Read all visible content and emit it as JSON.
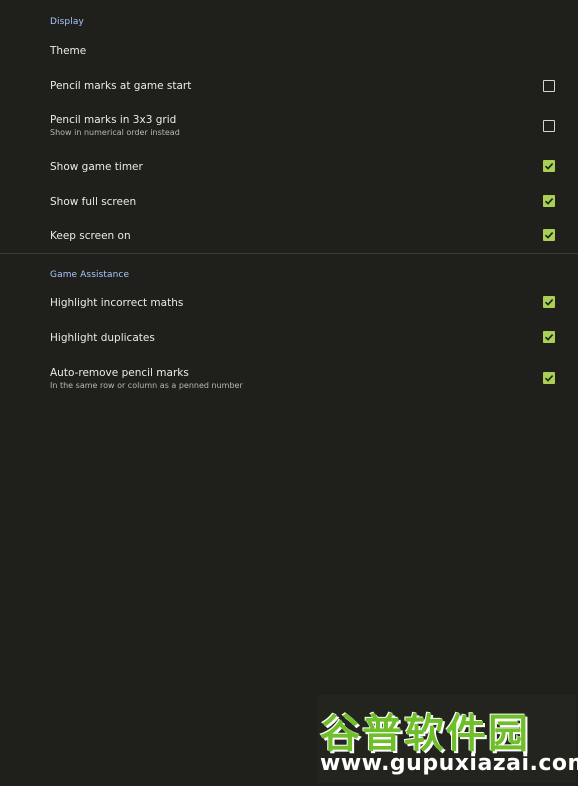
{
  "display": {
    "title": "Display",
    "items": [
      {
        "label": "Theme",
        "sub": "",
        "checked": null
      },
      {
        "label": "Pencil marks at game start",
        "sub": "",
        "checked": false
      },
      {
        "label": "Pencil marks in 3x3 grid",
        "sub": "Show in numerical order instead",
        "checked": false
      },
      {
        "label": "Show game timer",
        "sub": "",
        "checked": true
      },
      {
        "label": "Show full screen",
        "sub": "",
        "checked": true
      },
      {
        "label": "Keep screen on",
        "sub": "",
        "checked": true
      }
    ]
  },
  "assistance": {
    "title": "Game Assistance",
    "items": [
      {
        "label": "Highlight incorrect maths",
        "sub": "",
        "checked": true
      },
      {
        "label": "Highlight duplicates",
        "sub": "",
        "checked": true
      },
      {
        "label": "Auto-remove pencil marks",
        "sub": "In the same row or column as a penned number",
        "checked": true
      }
    ]
  },
  "watermark": {
    "cn": "谷普软件园",
    "url": "www.gupuxiazai.com"
  },
  "colors": {
    "background": "#1f1f1b",
    "accent": "#a9c7ff",
    "checkbox_on": "#a9cf54"
  }
}
